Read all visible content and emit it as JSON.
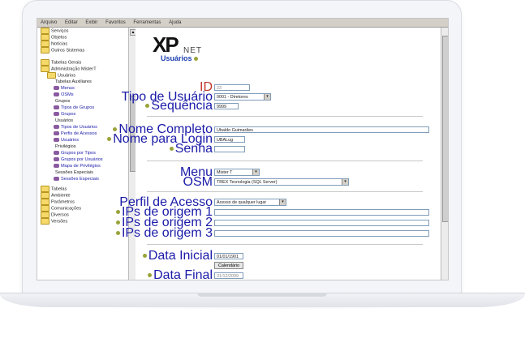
{
  "browser_menu": [
    "Arquivo",
    "Editar",
    "Exibir",
    "Favoritos",
    "Ferramentas",
    "Ajuda"
  ],
  "sidebar": {
    "items": [
      {
        "label": "Serviços",
        "type": "folder",
        "indent": 0
      },
      {
        "label": "Objetos",
        "type": "folder",
        "indent": 0
      },
      {
        "label": "Notícias",
        "type": "folder",
        "indent": 0
      },
      {
        "label": "Outros Sistemas",
        "type": "folder",
        "indent": 0
      },
      {
        "label": "Tabelas Gerais",
        "type": "folder",
        "indent": 0
      },
      {
        "label": "Administração MisterT",
        "type": "folder",
        "indent": 0
      },
      {
        "label": "Usuários",
        "type": "folder",
        "indent": 1
      },
      {
        "label": "Tabelas Auxiliares",
        "type": "text",
        "indent": 2
      },
      {
        "label": "Menus",
        "type": "key",
        "indent": 2
      },
      {
        "label": "OSMs",
        "type": "key",
        "indent": 2
      },
      {
        "label": "Grupos",
        "type": "text",
        "indent": 2
      },
      {
        "label": "Tipos de Grupos",
        "type": "key",
        "indent": 2
      },
      {
        "label": "Grupos",
        "type": "key",
        "indent": 2
      },
      {
        "label": "Usuários",
        "type": "text",
        "indent": 2
      },
      {
        "label": "Tipos de Usuários",
        "type": "key",
        "indent": 2
      },
      {
        "label": "Perfis de Acessos",
        "type": "key",
        "indent": 2
      },
      {
        "label": "Usuários",
        "type": "key",
        "indent": 2
      },
      {
        "label": "Privilégios",
        "type": "text",
        "indent": 2
      },
      {
        "label": "Grupos por Tipos",
        "type": "key",
        "indent": 2
      },
      {
        "label": "Grupos por Usuários",
        "type": "key",
        "indent": 2
      },
      {
        "label": "Mapa de Privilégios",
        "type": "key",
        "indent": 2
      },
      {
        "label": "Sessões Especiais",
        "type": "text",
        "indent": 2
      },
      {
        "label": "Sessões Especiais",
        "type": "key",
        "indent": 2
      },
      {
        "label": "Tabelas",
        "type": "folder",
        "indent": 0
      },
      {
        "label": "Ambiente",
        "type": "folder",
        "indent": 0
      },
      {
        "label": "Parâmetros",
        "type": "folder",
        "indent": 0
      },
      {
        "label": "Comunicações",
        "type": "folder",
        "indent": 0
      },
      {
        "label": "Diversos",
        "type": "folder",
        "indent": 0
      },
      {
        "label": "Versões",
        "type": "folder",
        "indent": 0
      }
    ]
  },
  "header": {
    "logo_main": "XP",
    "logo_sub": "NET",
    "title": "Usuários"
  },
  "form": {
    "id_label": "ID",
    "id_value": "23",
    "tipo_label": "Tipo de Usuário",
    "tipo_value": "0001 - Diretores",
    "seq_label": "Sequência",
    "seq_value": "9999",
    "nome_label": "Nome Completo",
    "nome_value": "Ubaldo Guimarães",
    "login_label": "Nome para Login",
    "login_value": "UBALug",
    "senha_label": "Senha",
    "senha_value": "",
    "menu_label": "Menu",
    "menu_value": "Mister T",
    "osm_label": "OSM",
    "osm_value": "TREX Tecnologia (SQL Server)",
    "perfil_label": "Perfil de Acesso",
    "perfil_value": "Acesso de qualquer lugar",
    "ip1_label": "IPs de origem 1",
    "ip2_label": "IPs de origem 2",
    "ip3_label": "IPs de origem 3",
    "data_ini_label": "Data Inicial",
    "data_ini_value": "01/01/1901",
    "calendar_button": "Calendário",
    "data_fim_label": "Data Final",
    "data_fim_value": "31/12/2099"
  }
}
